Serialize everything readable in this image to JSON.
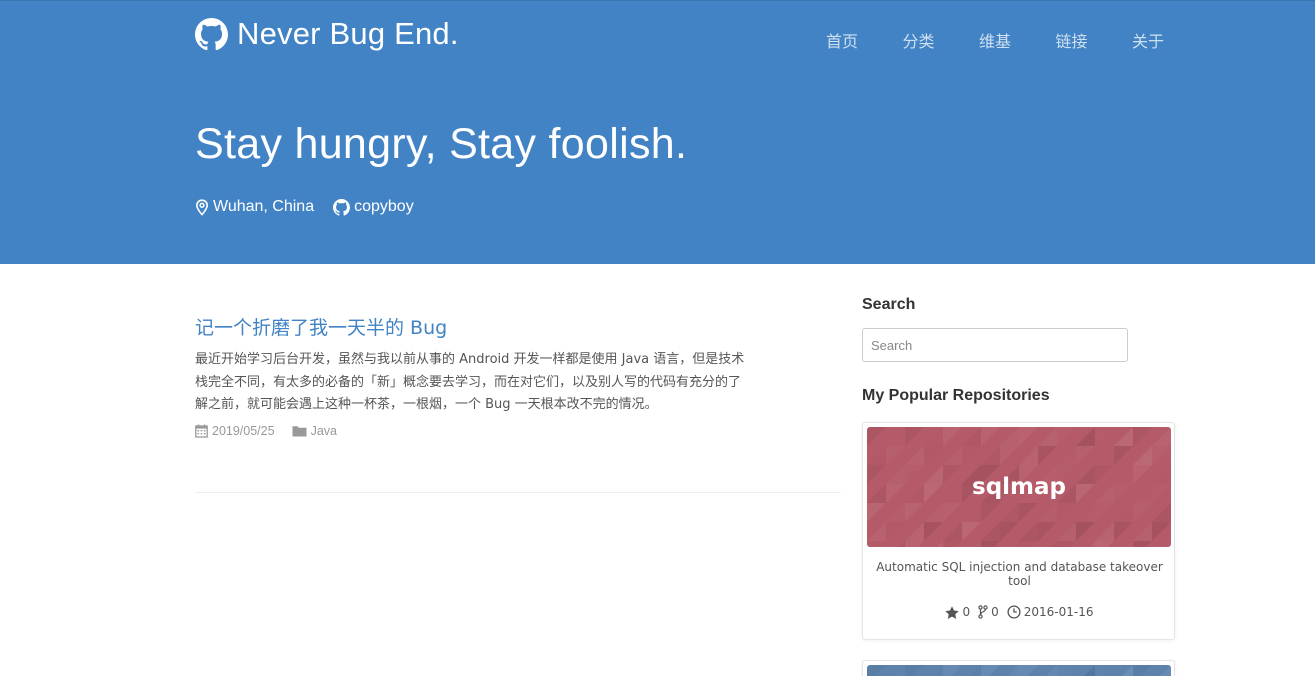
{
  "site": {
    "title": "Never Bug End."
  },
  "nav": [
    "首页",
    "分类",
    "维基",
    "链接",
    "关于"
  ],
  "hero": {
    "title": "Stay hungry, Stay foolish.",
    "location": "Wuhan, China",
    "github_user": "copyboy"
  },
  "posts": [
    {
      "title": "记一个折磨了我一天半的 Bug",
      "excerpt": "最近开始学习后台开发，虽然与我以前从事的 Android 开发一样都是使用 Java 语言，但是技术栈完全不同，有太多的必备的「新」概念要去学习，而在对它们，以及别人写的代码有充分的了解之前，就可能会遇上这种一杯茶，一根烟，一个 Bug 一天根本改不完的情况。",
      "date": "2019/05/25",
      "category": "Java"
    }
  ],
  "sidebar": {
    "search_heading": "Search",
    "search_placeholder": "Search",
    "repos_heading": "My Popular Repositories",
    "repos": [
      {
        "name": "sqlmap",
        "description": "Automatic SQL injection and database takeover tool",
        "stars": "0",
        "forks": "0",
        "updated": "2016-01-16",
        "banner_color": "#b55a68"
      }
    ],
    "next_repo_banner_color": "#5d83ad"
  },
  "colors": {
    "header_bg": "#4183c4",
    "link": "#4183c4"
  },
  "icons": [
    "github-icon",
    "map-marker-icon",
    "calendar-icon",
    "folder-icon",
    "star-icon",
    "fork-icon",
    "clock-icon"
  ]
}
